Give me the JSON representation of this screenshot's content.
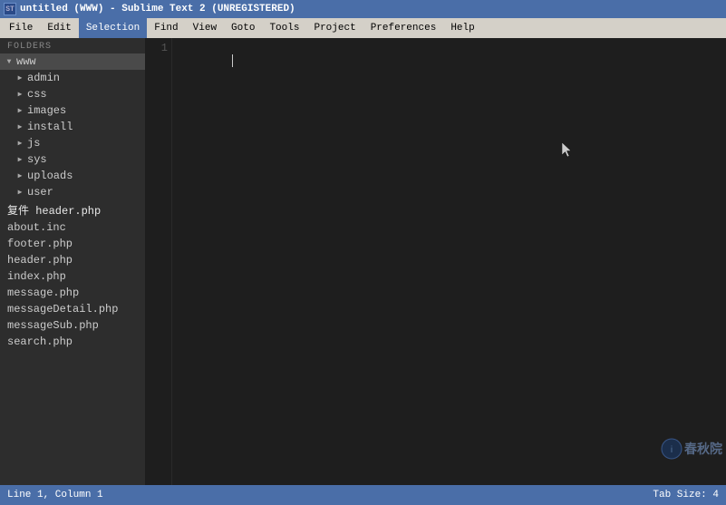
{
  "titlebar": {
    "icon": "ST",
    "title": "untitled (WWW) - Sublime Text 2 (UNREGISTERED)"
  },
  "menubar": {
    "items": [
      "File",
      "Edit",
      "Selection",
      "Find",
      "View",
      "Goto",
      "Tools",
      "Project",
      "Preferences",
      "Help"
    ]
  },
  "sidebar": {
    "folders_label": "FOLDERS",
    "tree": [
      {
        "id": "www",
        "label": "www",
        "type": "folder",
        "open": true,
        "indent": 0
      },
      {
        "id": "admin",
        "label": "admin",
        "type": "folder",
        "open": false,
        "indent": 1
      },
      {
        "id": "css",
        "label": "css",
        "type": "folder",
        "open": false,
        "indent": 1
      },
      {
        "id": "images",
        "label": "images",
        "type": "folder",
        "open": false,
        "indent": 1
      },
      {
        "id": "install",
        "label": "install",
        "type": "folder",
        "open": false,
        "indent": 1
      },
      {
        "id": "js",
        "label": "js",
        "type": "folder",
        "open": false,
        "indent": 1
      },
      {
        "id": "sys",
        "label": "sys",
        "type": "folder",
        "open": false,
        "indent": 1
      },
      {
        "id": "uploads",
        "label": "uploads",
        "type": "folder",
        "open": false,
        "indent": 1
      },
      {
        "id": "user",
        "label": "user",
        "type": "folder",
        "open": false,
        "indent": 1
      },
      {
        "id": "header-special",
        "label": "复件 header.php",
        "type": "file",
        "indent": 0,
        "special": true
      },
      {
        "id": "about-inc",
        "label": "about.inc",
        "type": "file",
        "indent": 0
      },
      {
        "id": "footer-php",
        "label": "footer.php",
        "type": "file",
        "indent": 0
      },
      {
        "id": "header-php",
        "label": "header.php",
        "type": "file",
        "indent": 0
      },
      {
        "id": "index-php",
        "label": "index.php",
        "type": "file",
        "indent": 0
      },
      {
        "id": "message-php",
        "label": "message.php",
        "type": "file",
        "indent": 0
      },
      {
        "id": "messagedetail-php",
        "label": "messageDetail.php",
        "type": "file",
        "indent": 0
      },
      {
        "id": "messagesub-php",
        "label": "messageSub.php",
        "type": "file",
        "indent": 0
      },
      {
        "id": "search-php",
        "label": "search.php",
        "type": "file",
        "indent": 0
      }
    ]
  },
  "editor": {
    "line_number": "1",
    "content": ""
  },
  "statusbar": {
    "left": "Line 1, Column 1",
    "right": "Tab Size: 4"
  },
  "watermark": {
    "text": "春秋院"
  }
}
